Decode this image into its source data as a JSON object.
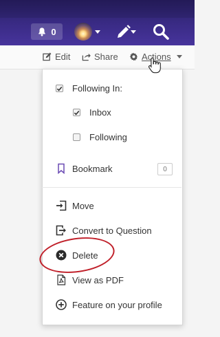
{
  "topbar": {
    "notifications_count": "0",
    "icons": [
      "bell-icon",
      "avatar",
      "pen-icon",
      "search-icon"
    ]
  },
  "subbar": {
    "edit_label": "Edit",
    "share_label": "Share",
    "actions_label": "Actions"
  },
  "dropdown": {
    "following_in_label": "Following In:",
    "following_in_checked": true,
    "inbox_label": "Inbox",
    "inbox_checked": true,
    "following_label": "Following",
    "following_checked": false,
    "bookmark_label": "Bookmark",
    "bookmark_count": "0",
    "move_label": "Move",
    "convert_label": "Convert to Question",
    "delete_label": "Delete",
    "pdf_label": "View as PDF",
    "feature_label": "Feature on your profile"
  },
  "colors": {
    "topbar": "#3a2b86",
    "highlight_circle": "#c0202a"
  }
}
